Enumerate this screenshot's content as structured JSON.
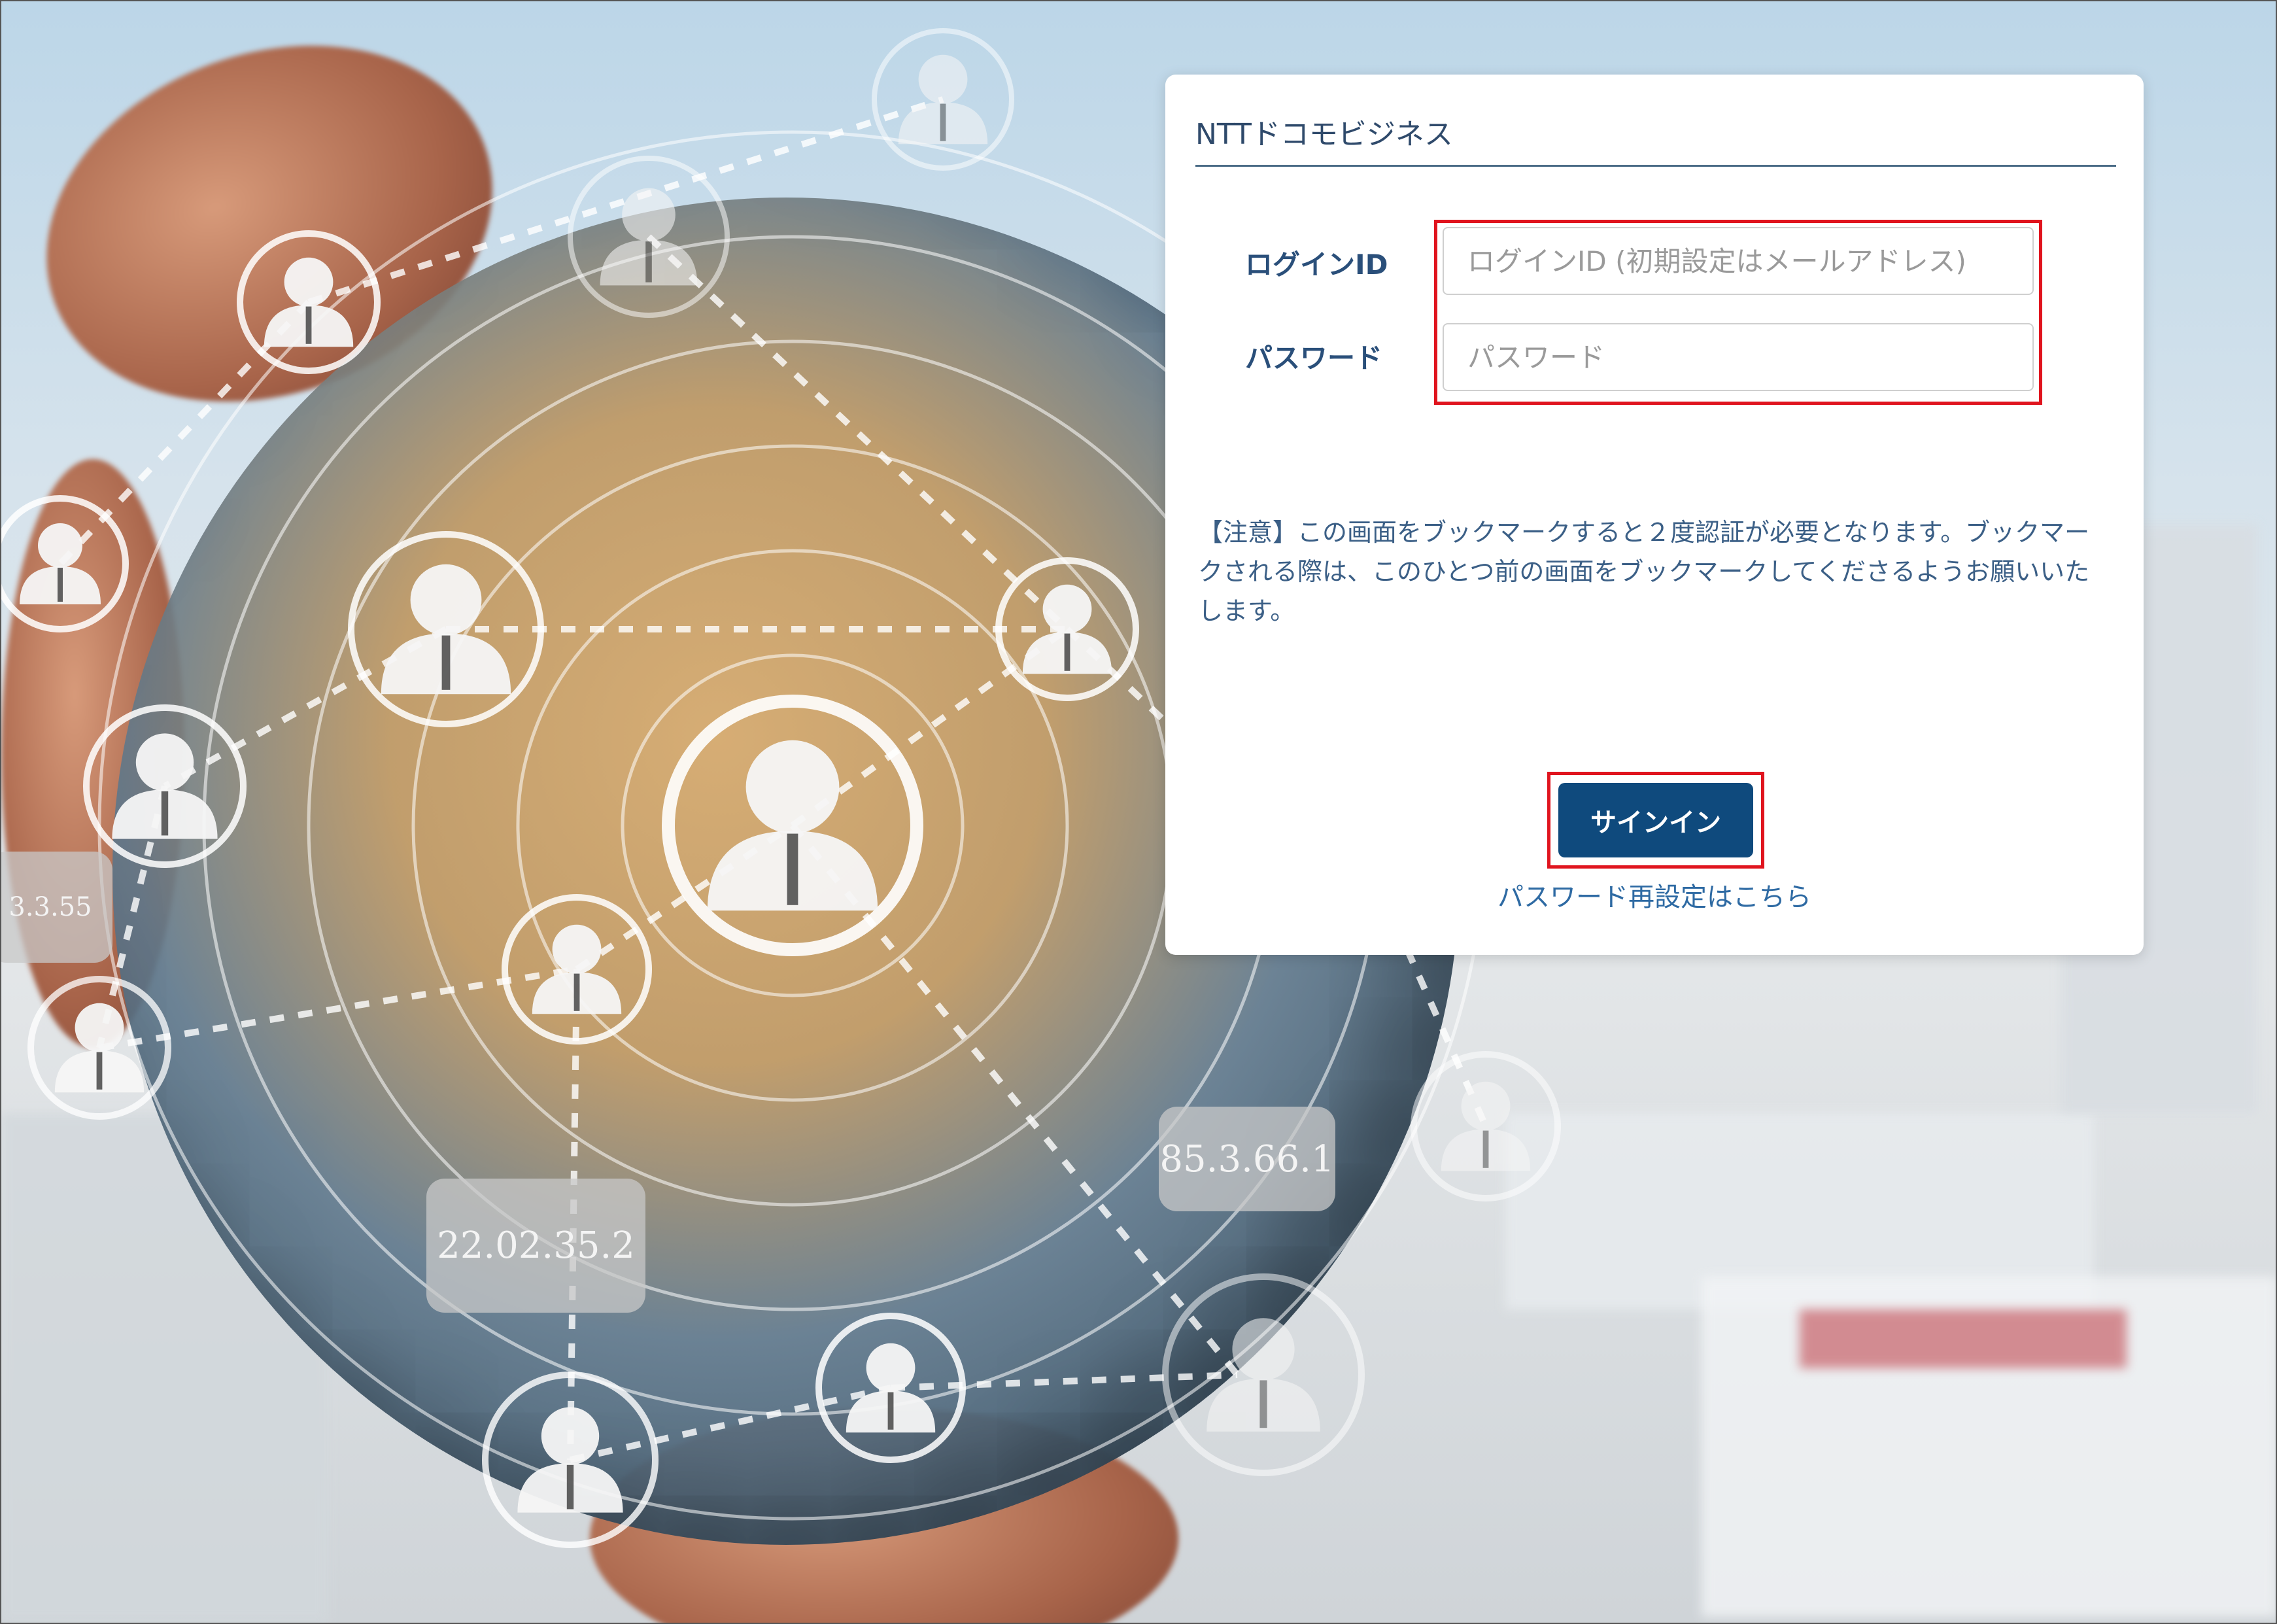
{
  "background": {
    "ip_labels": [
      "3.3.55",
      "85.3.66.1",
      "22.02.35.2"
    ]
  },
  "card": {
    "brand": "NTTドコモビジネス",
    "login_id_label": "ログインID",
    "login_id_placeholder": "ログインID (初期設定はメールアドレス)",
    "login_id_value": "",
    "password_label": "パスワード",
    "password_placeholder": "パスワード",
    "password_value": "",
    "notice": "【注意】この画面をブックマークすると２度認証が必要となります。ブックマークされる際は、このひとつ前の画面をブックマークしてくださるようお願いいたします。",
    "signin_label": "サインイン",
    "reset_link": "パスワード再設定はこちら"
  },
  "colors": {
    "primary_button": "#0f4a7d",
    "highlight_box": "#e0141e",
    "label_text": "#2a4f7a",
    "link": "#2e6aa3"
  },
  "icons": [
    "person-icon"
  ]
}
